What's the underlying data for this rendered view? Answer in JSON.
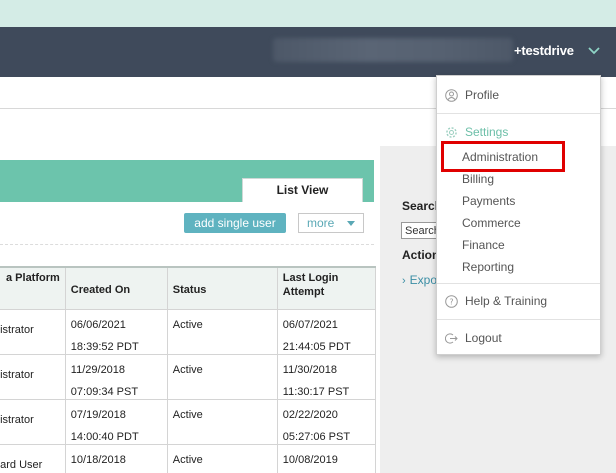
{
  "header": {
    "user_name_suffix": "+testdrive",
    "menu_caret_icon": "chevron-down-icon"
  },
  "tabs": {
    "list_view": "List View"
  },
  "toolbar": {
    "add_single_user": "add single user",
    "more": "more"
  },
  "table": {
    "headers": {
      "platform_l1": "a Platform",
      "platform_l2": "",
      "created_l1": "Created On",
      "status": "Status",
      "last_login_l1": "Last Login",
      "last_login_l2": "Attempt"
    },
    "rows": [
      {
        "role": "nistrator",
        "created_date": "06/06/2021",
        "created_time": "18:39:52 PDT",
        "status": "Active",
        "login_date": "06/07/2021",
        "login_time": "21:44:05 PDT"
      },
      {
        "role": "nistrator",
        "created_date": "11/29/2018",
        "created_time": "07:09:34 PST",
        "status": "Active",
        "login_date": "11/30/2018",
        "login_time": "11:30:17 PST"
      },
      {
        "role": "nistrator",
        "created_date": "07/19/2018",
        "created_time": "14:00:40 PDT",
        "status": "Active",
        "login_date": "02/22/2020",
        "login_time": "05:27:06 PST"
      },
      {
        "role": "dard User",
        "created_date": "10/18/2018",
        "created_time": "",
        "status": "Active",
        "login_date": "10/08/2019",
        "login_time": ""
      }
    ]
  },
  "side_panel": {
    "search_label": "Search",
    "search_value": "Search",
    "actions_label": "Action",
    "export_link": "Expo"
  },
  "dropdown": {
    "profile": "Profile",
    "settings": "Settings",
    "settings_items": [
      "Administration",
      "Billing",
      "Payments",
      "Commerce",
      "Finance",
      "Reporting"
    ],
    "help": "Help & Training",
    "logout": "Logout",
    "icons": {
      "profile": "user-icon",
      "settings": "gear-icon",
      "help": "question-icon",
      "logout": "logout-icon"
    }
  },
  "colors": {
    "header_bg": "#3f4a5b",
    "accent_teal": "#6cc4ac",
    "button_blue": "#5fb3c0",
    "highlight_red": "#e00000"
  }
}
